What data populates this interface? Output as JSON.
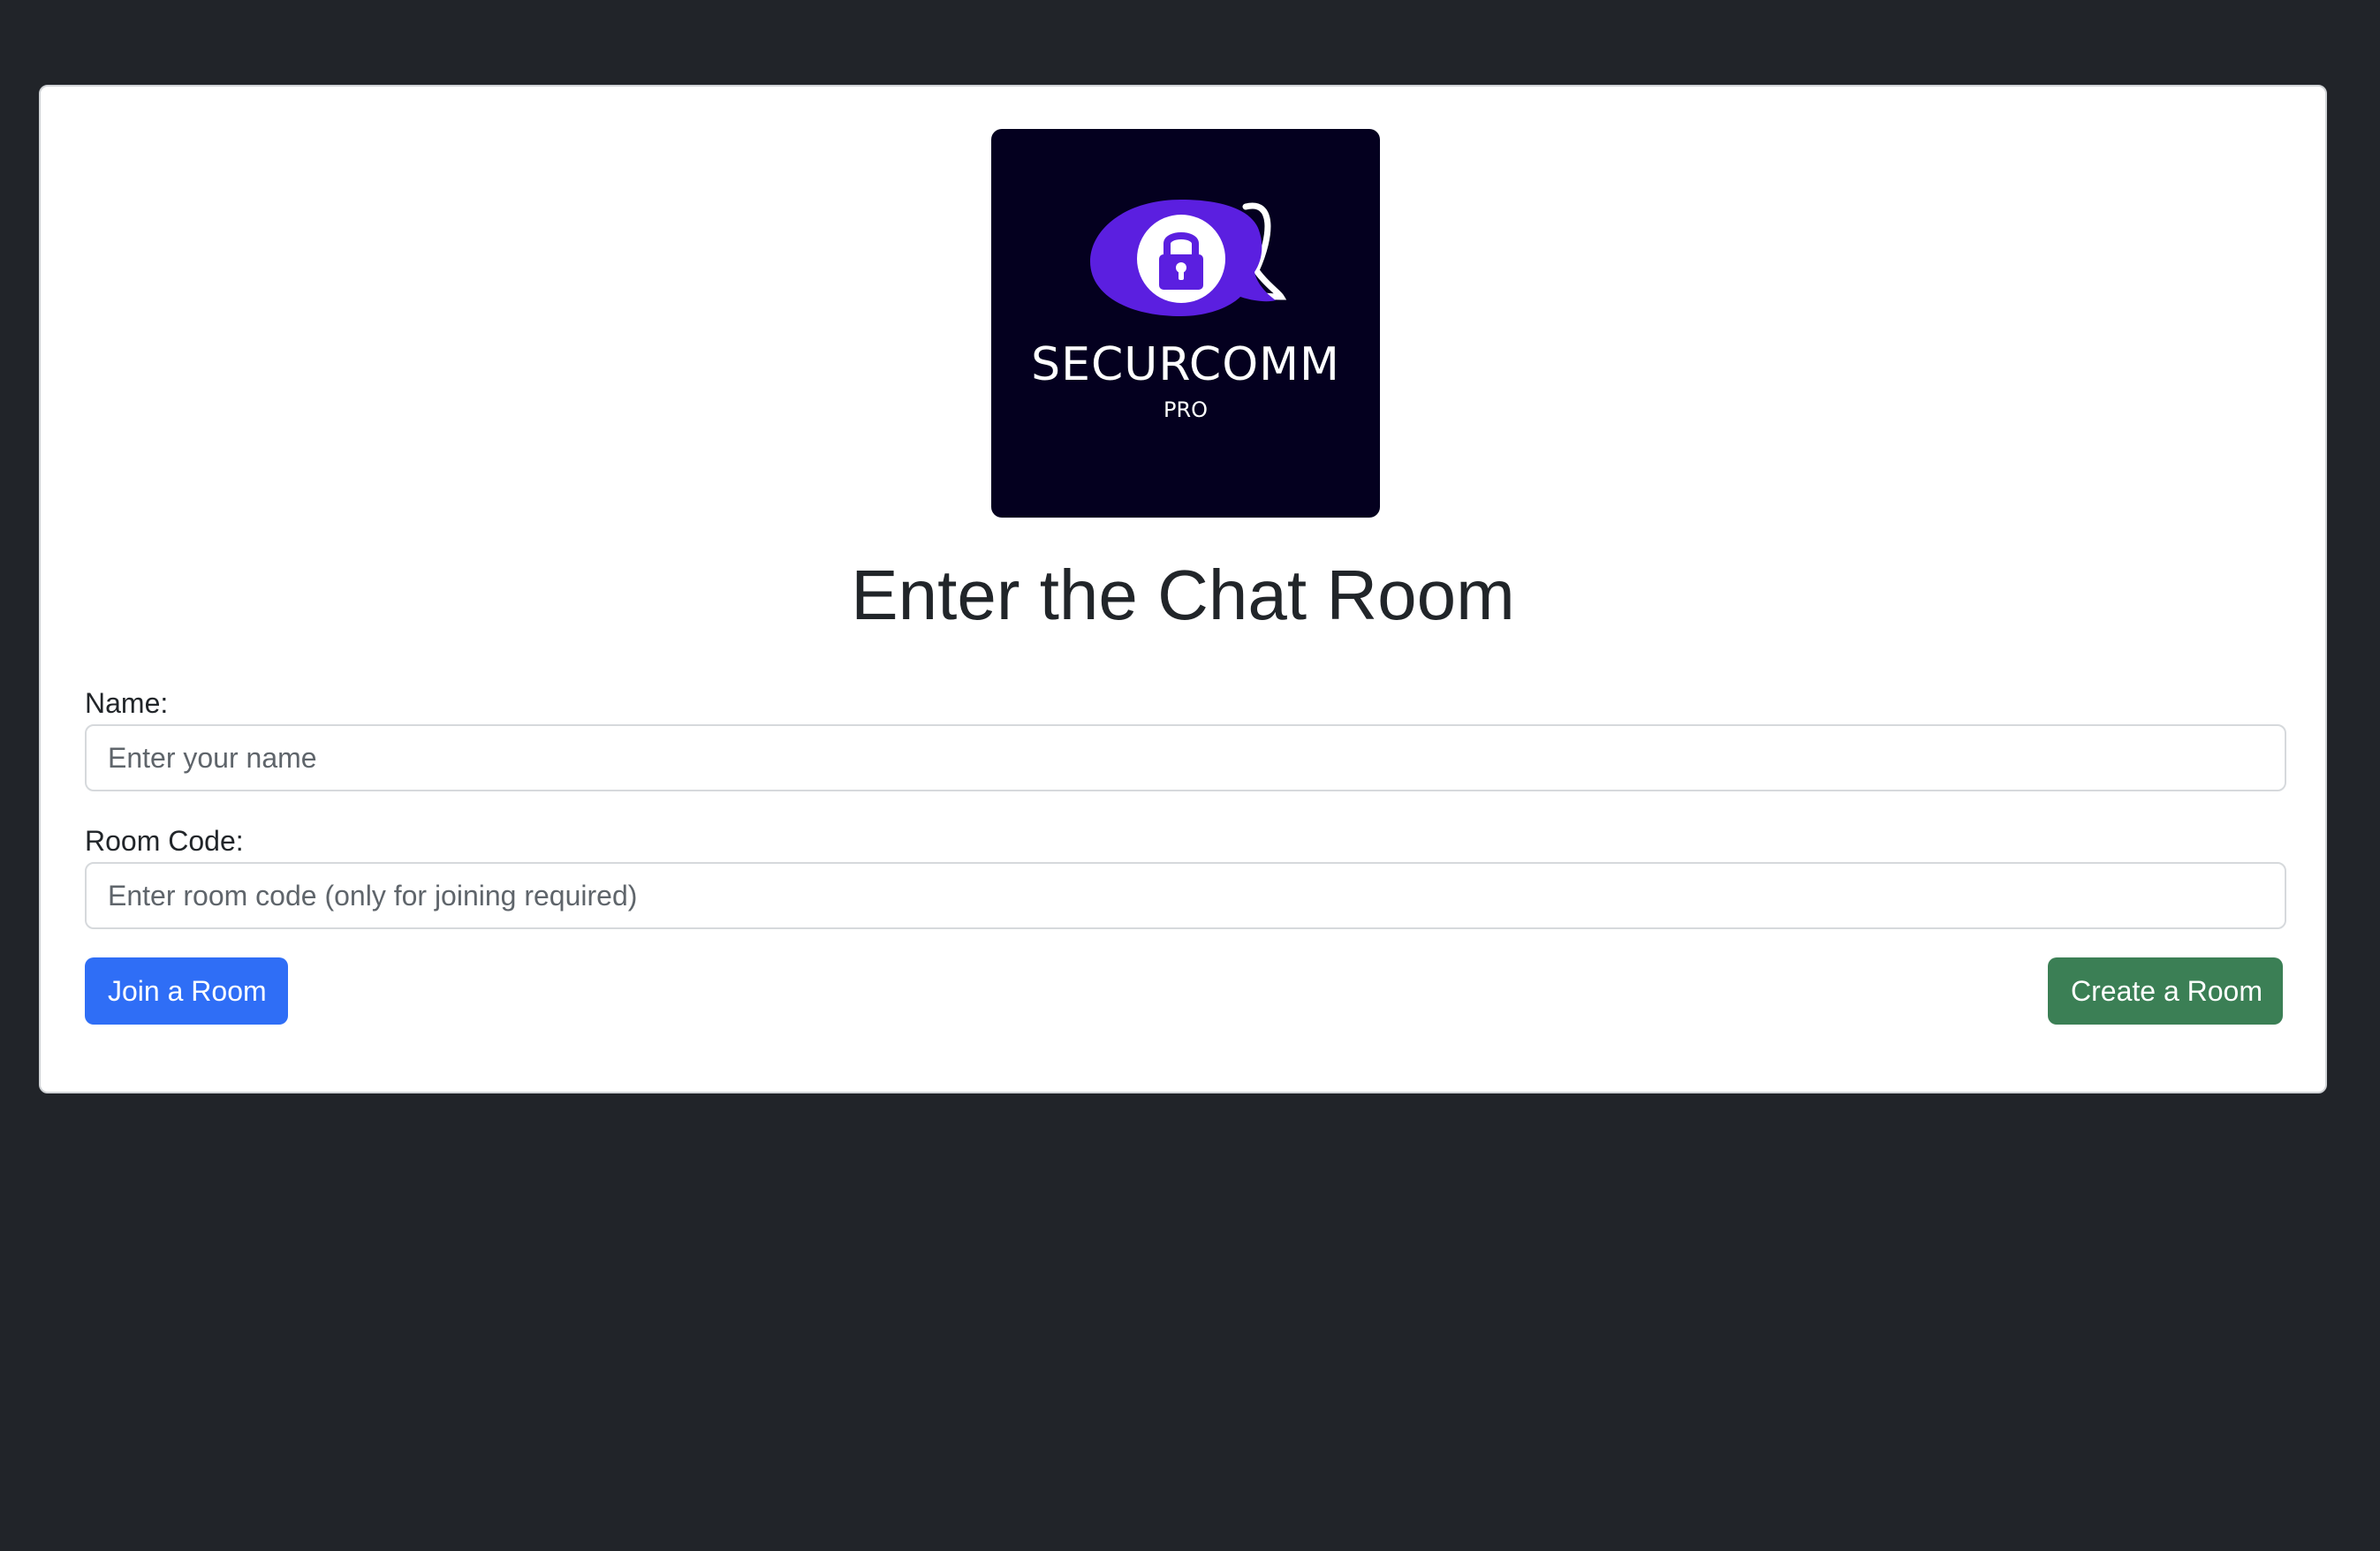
{
  "colors": {
    "page_background": "#212429",
    "card_background": "#ffffff",
    "logo_background": "#04001f",
    "logo_bubble": "#5b1fe0",
    "join_button": "#2f6ef6",
    "create_button": "#3b7f55"
  },
  "logo": {
    "brand_name": "SECURCOMM",
    "brand_tier": "PRO",
    "icon": "lock-chat-bubble-icon"
  },
  "main": {
    "title": "Enter the Chat Room"
  },
  "form": {
    "name": {
      "label": "Name:",
      "value": "",
      "placeholder": "Enter your name"
    },
    "room_code": {
      "label": "Room Code:",
      "value": "",
      "placeholder": "Enter room code (only for joining required)"
    }
  },
  "actions": {
    "join_label": "Join a Room",
    "create_label": "Create a Room"
  }
}
